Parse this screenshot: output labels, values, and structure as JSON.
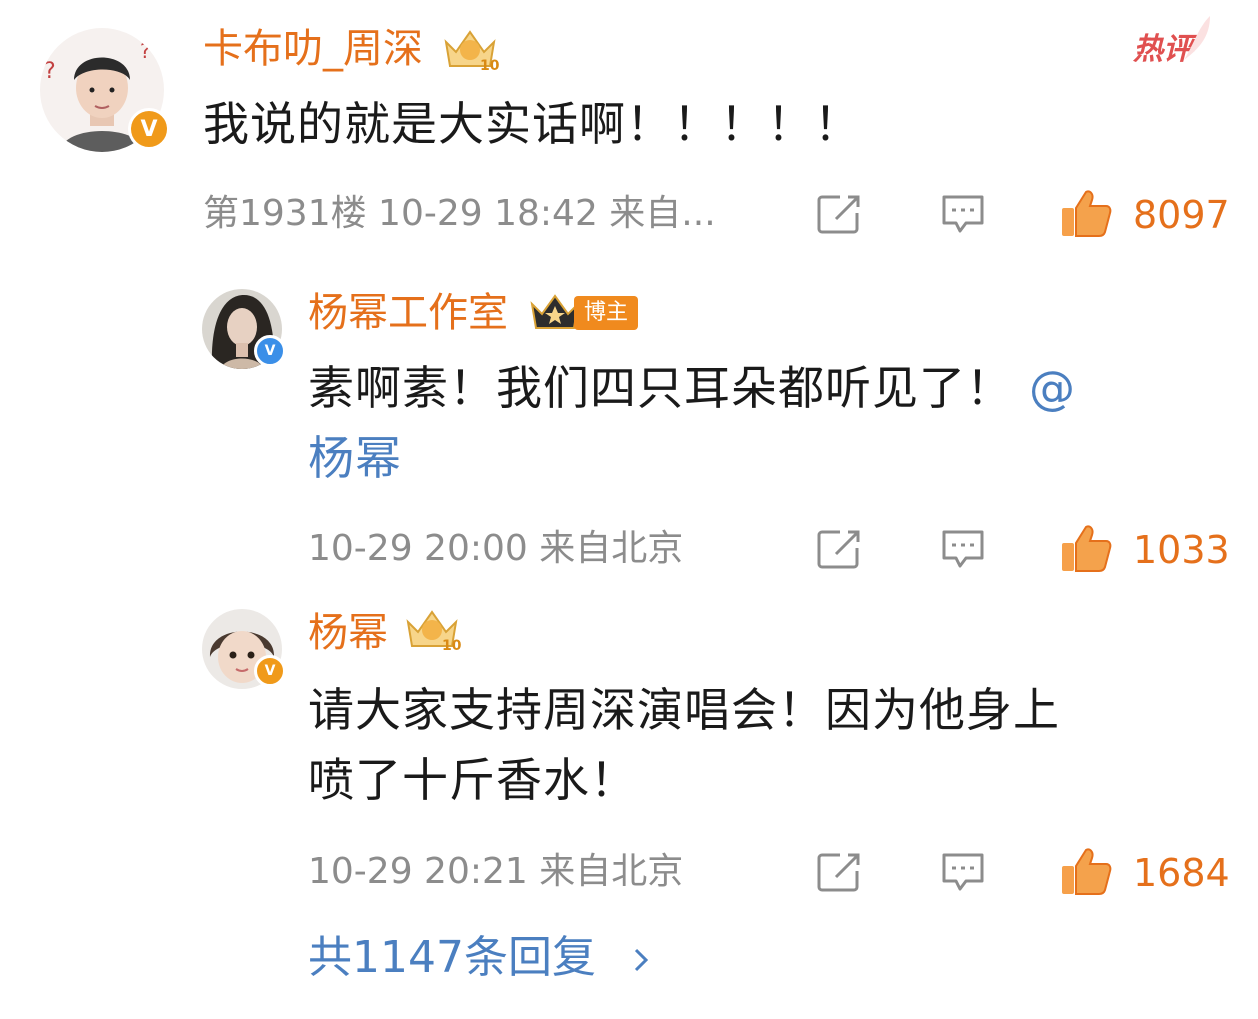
{
  "hot_label": "热评",
  "main_comment": {
    "username": "卡布叻_周深",
    "content": "我说的就是大实话啊！！！！！",
    "floor_time": "第1931楼 10-29 18:42 来自...",
    "likes": "8097",
    "verified": "V"
  },
  "replies": [
    {
      "username": "杨幂工作室",
      "tag": "博主",
      "content_line1": "素啊素！我们四只耳朵都听见了！",
      "mention_line1": "@",
      "mention_line2": "杨幂",
      "time_location": "10-29 20:00 来自北京",
      "likes": "1033",
      "verified": "V"
    },
    {
      "username": "杨幂",
      "content_line1": "请大家支持周深演唱会！因为他身上",
      "content_line2": "喷了十斤香水！",
      "time_location": "10-29 20:21 来自北京",
      "likes": "1684",
      "verified": "V"
    }
  ],
  "more_replies": "共1147条回复",
  "colors": {
    "username": "#e5701b",
    "mention": "#4b7fc0",
    "meta": "#8c8c8c",
    "like": "#e5701b",
    "hot": "#e05050"
  }
}
